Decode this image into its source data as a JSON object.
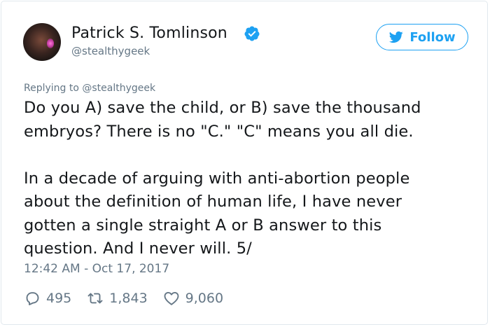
{
  "author": {
    "display_name": "Patrick S. Tomlinson",
    "handle": "@stealthygeek",
    "verified": true,
    "verified_color": "#1da1f2"
  },
  "follow": {
    "label": "Follow",
    "accent": "#1da1f2"
  },
  "reply_context": {
    "prefix": "Replying to ",
    "mention": "@stealthygeek"
  },
  "tweet": {
    "text": "Do you A) save the child, or B) save the thousand\nembryos? There is no \"C.\" \"C\" means you all die.\n\nIn a decade of arguing with anti-abortion people\nabout the definition of human life, I have never\ngotten a single straight A or B answer to this\nquestion. And I never will. 5/",
    "timestamp": "12:42 AM - Oct 17, 2017"
  },
  "actions": {
    "replies": "495",
    "retweets": "1,843",
    "likes": "9,060"
  },
  "icons": {
    "verified": "verified-badge-icon",
    "bird": "twitter-bird-icon",
    "reply": "reply-bubble-icon",
    "retweet": "retweet-icon",
    "like": "heart-icon"
  }
}
